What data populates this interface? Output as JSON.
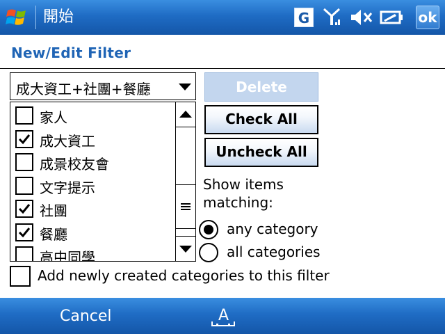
{
  "titlebar": {
    "title": "開始",
    "g_label": "G",
    "ok_label": "ok"
  },
  "page": {
    "title": "New/Edit Filter"
  },
  "filter": {
    "selected": "成大資工+社團+餐廳"
  },
  "categories": [
    {
      "label": "家人",
      "checked": false
    },
    {
      "label": "成大資工",
      "checked": true
    },
    {
      "label": "成景校友會",
      "checked": false
    },
    {
      "label": "文字提示",
      "checked": false
    },
    {
      "label": "社團",
      "checked": true
    },
    {
      "label": "餐廳",
      "checked": true
    },
    {
      "label": "高中同學",
      "checked": false
    }
  ],
  "buttons": {
    "delete": "Delete",
    "check_all": "Check All",
    "uncheck_all": "Uncheck All"
  },
  "matching": {
    "label": "Show items matching:",
    "any": "any category",
    "all": "all categories",
    "selected": "any"
  },
  "add_new": {
    "label": "Add newly created categories to this filter",
    "checked": false
  },
  "softkeys": {
    "left": "Cancel",
    "kbd_label": "A"
  },
  "colors": {
    "title_bar": "#1f6cc4",
    "heading": "#1f64b5",
    "disabled_button": "#c3d6ee"
  }
}
